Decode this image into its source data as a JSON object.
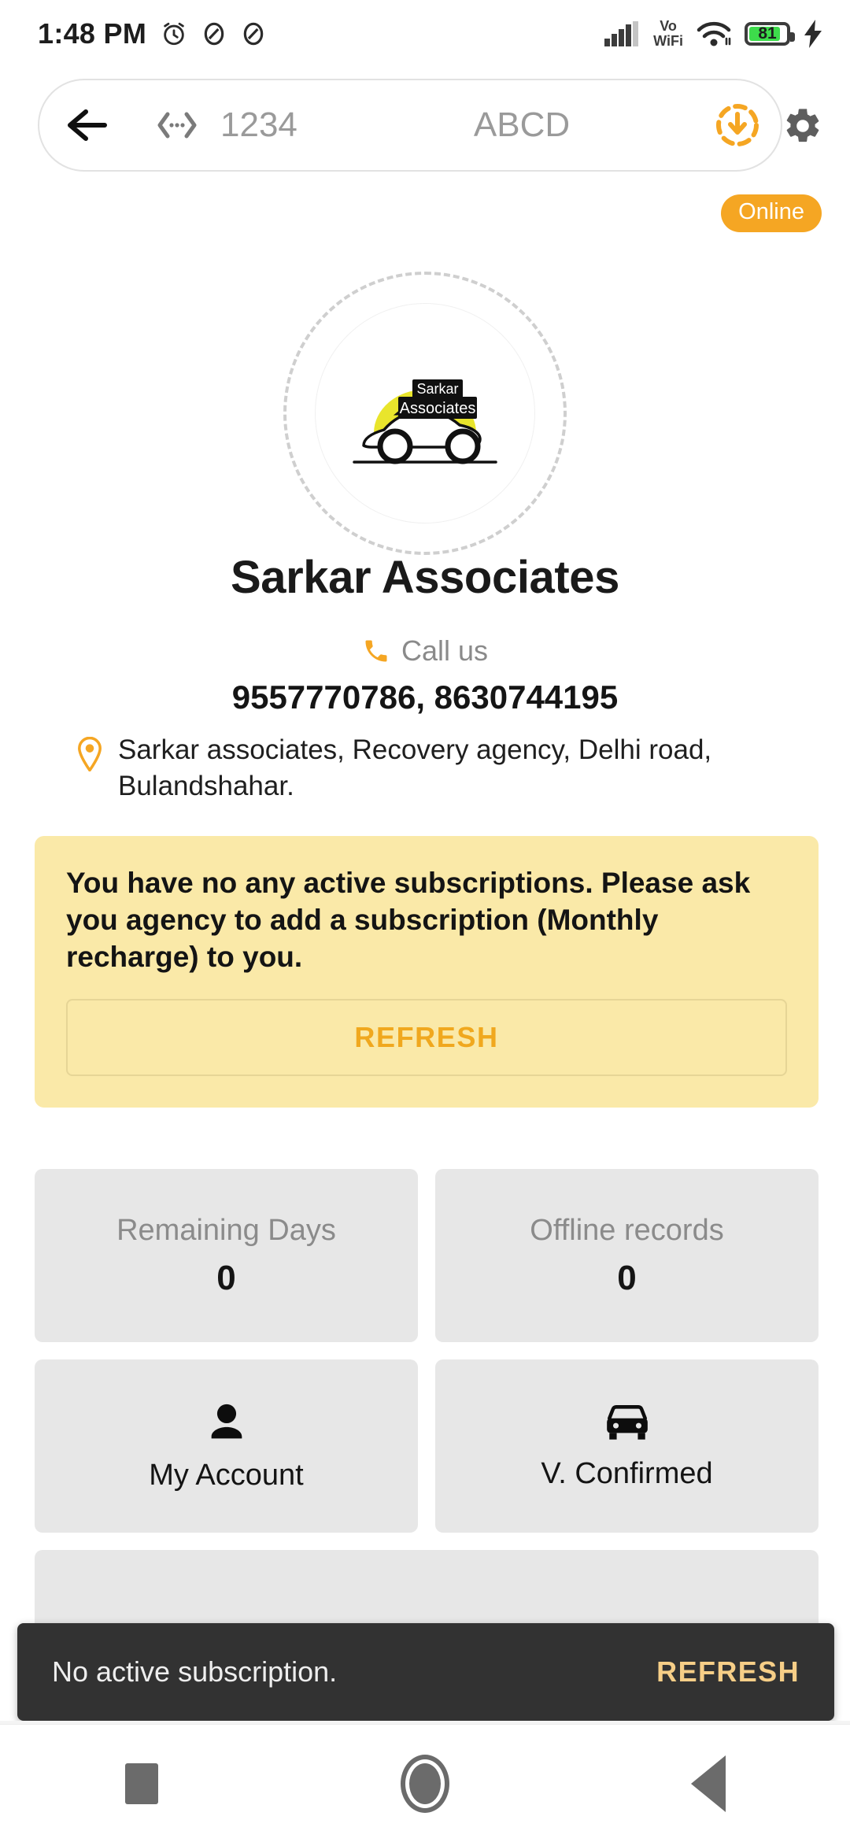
{
  "status_bar": {
    "time": "1:48 PM",
    "left_icons": [
      "alarm-icon",
      "do-not-disturb-icon",
      "do-not-disturb-icon"
    ],
    "network_label": "Vo\nWiFi",
    "network_label_line1": "Vo",
    "network_label_line2": "WiFi",
    "right_icons": [
      "signal-icon",
      "volte-wifi-icon",
      "wifi-icon",
      "battery-icon",
      "charging-icon"
    ],
    "battery_percent": "81",
    "battery_color": "#3ddc4b"
  },
  "topbar": {
    "back_icon": "back-arrow-icon",
    "dots_icon": "expand-horizontal-icon",
    "number_field": "1234",
    "text_field": "ABCD",
    "download_icon": "download-sync-icon",
    "settings_icon": "gear-icon",
    "accent": "#f5a623"
  },
  "status_badge": {
    "label": "Online",
    "color": "#f5a623"
  },
  "logo": {
    "name": "agency-logo",
    "brand_line1": "Sarkar",
    "brand_line2": "Associates",
    "sun_color": "#e9e52c"
  },
  "agency": {
    "title": "Sarkar Associates",
    "call_icon": "phone-icon",
    "call_label": "Call us",
    "phones": "9557770786, 8630744195",
    "location_icon": "location-pin-icon",
    "address": "Sarkar associates, Recovery agency, Delhi road, Bulandshahar."
  },
  "subscription_card": {
    "message": "You have no any active subscriptions. Please ask you agency to add a subscription (Monthly recharge) to you.",
    "refresh_label": "REFRESH",
    "background": "#fae9a8",
    "refresh_color": "#f0a81e"
  },
  "tiles": {
    "row1": [
      {
        "label": "Remaining Days",
        "value": "0"
      },
      {
        "label": "Offline records",
        "value": "0"
      }
    ],
    "row2": [
      {
        "label": "My Account",
        "icon": "person-icon"
      },
      {
        "label": "V. Confirmed",
        "icon": "car-icon"
      }
    ],
    "row3": [
      {
        "label": "",
        "icon": "people-group-icon"
      }
    ]
  },
  "snackbar": {
    "message": "No active subscription.",
    "action_label": "REFRESH",
    "background": "#323232",
    "action_color": "#f6ce87"
  },
  "navbar": {
    "recents": "recents-square-icon",
    "home": "home-circle-icon",
    "back": "back-triangle-icon"
  }
}
